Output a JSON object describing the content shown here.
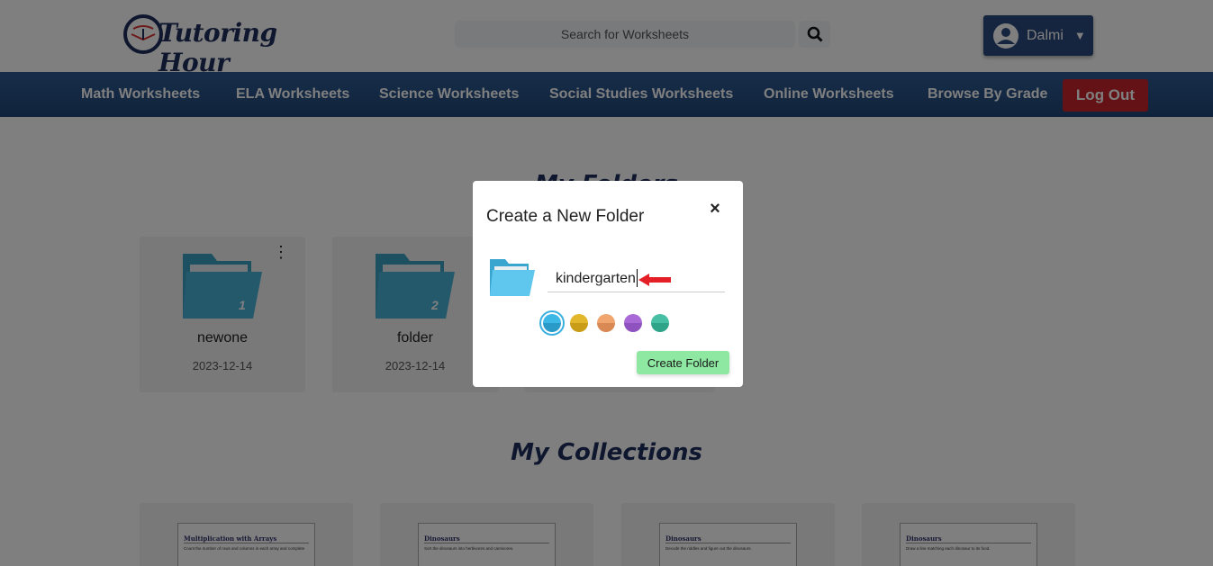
{
  "header": {
    "logo_text": "Tutoring Hour",
    "search_placeholder": "Search for Worksheets",
    "user_name": "Dalmi"
  },
  "nav": {
    "items": [
      {
        "label": "Math Worksheets"
      },
      {
        "label": "ELA Worksheets"
      },
      {
        "label": "Science Worksheets"
      },
      {
        "label": "Social Studies Worksheets"
      },
      {
        "label": "Online Worksheets"
      },
      {
        "label": "Browse By Grade"
      }
    ],
    "logout_label": "Log Out"
  },
  "folders": {
    "title": "My Folders",
    "items": [
      {
        "name": "newone",
        "date": "2023-12-14",
        "count": "1"
      },
      {
        "name": "folder",
        "date": "2023-12-14",
        "count": "2"
      }
    ]
  },
  "collections": {
    "title": "My Collections",
    "items": [
      {
        "thumb_title": "Multiplication with Arrays",
        "thumb_text": "Count the number of rows and columns in each array and complete"
      },
      {
        "thumb_title": "Dinosaurs",
        "thumb_text": "Sort the dinosaurs into herbivores and carnivores."
      },
      {
        "thumb_title": "Dinosaurs",
        "thumb_text": "Decode the riddles and figure out the dinosaurs."
      },
      {
        "thumb_title": "Dinosaurs",
        "thumb_text": "Draw a line matching each dinosaur to its food."
      }
    ]
  },
  "modal": {
    "title": "Create a New Folder",
    "close_label": "×",
    "input_value": "kindergarten",
    "create_label": "Create Folder",
    "colors": [
      "#3cb8e6",
      "#e2b72c",
      "#f0a46e",
      "#a96ad6",
      "#46bfa5"
    ],
    "selected_color_index": 0
  },
  "colors": {
    "accent": "#2b4a7e",
    "nav_bg": "#2e5b94",
    "logout": "#c8242b",
    "folder": "#3cb8e6",
    "create_button": "#8ee8a1"
  }
}
